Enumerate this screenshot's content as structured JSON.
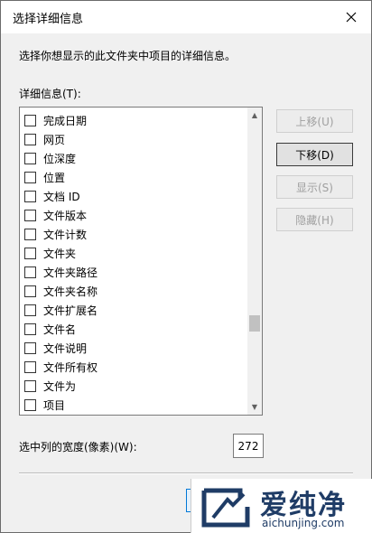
{
  "window": {
    "title": "选择详细信息"
  },
  "description": "选择你想显示的此文件夹中项目的详细信息。",
  "list": {
    "label": "详细信息(T):",
    "items": [
      {
        "label": "完成日期",
        "checked": false
      },
      {
        "label": "网页",
        "checked": false
      },
      {
        "label": "位深度",
        "checked": false
      },
      {
        "label": "位置",
        "checked": false
      },
      {
        "label": "文档 ID",
        "checked": false
      },
      {
        "label": "文件版本",
        "checked": false
      },
      {
        "label": "文件计数",
        "checked": false
      },
      {
        "label": "文件夹",
        "checked": false
      },
      {
        "label": "文件夹路径",
        "checked": false
      },
      {
        "label": "文件夹名称",
        "checked": false
      },
      {
        "label": "文件扩展名",
        "checked": false
      },
      {
        "label": "文件名",
        "checked": false
      },
      {
        "label": "文件说明",
        "checked": false
      },
      {
        "label": "文件所有权",
        "checked": false
      },
      {
        "label": "文件为",
        "checked": false
      },
      {
        "label": "项目",
        "checked": false
      }
    ]
  },
  "buttons": {
    "move_up": "上移(U)",
    "move_down": "下移(D)",
    "show": "显示(S)",
    "hide": "隐藏(H)"
  },
  "width": {
    "label": "选中列的宽度(像素)(W):",
    "value": "272"
  },
  "watermark": {
    "title": "爱纯净",
    "url": "aichunjing.com"
  },
  "colors": {
    "dialog_bg": "#f0f0f0",
    "watermark_blue": "#1f3c66"
  }
}
